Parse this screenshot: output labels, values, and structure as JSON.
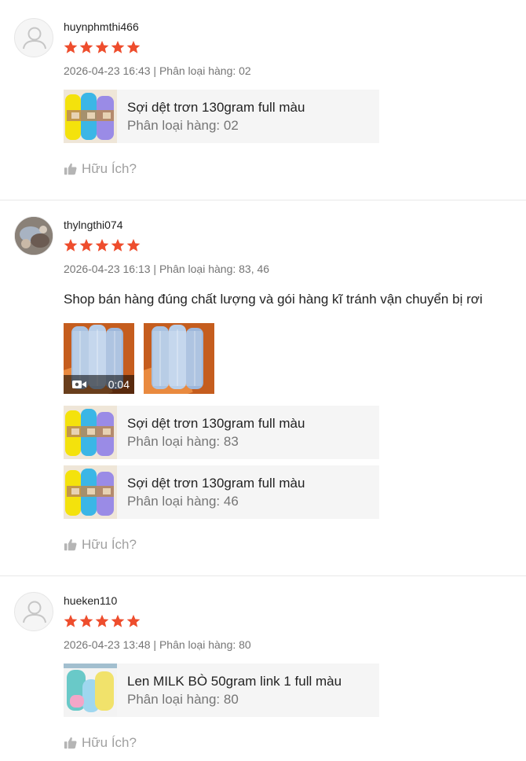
{
  "colors": {
    "star": "#ee4d2d",
    "muted": "#757575",
    "helpful": "#a0a0a0"
  },
  "reviews": [
    {
      "username": "huynphmthi466",
      "rating": 5,
      "meta": "2026-04-23 16:43 | Phân loại hàng: 02",
      "helpful_label": "Hữu Ích?",
      "products": [
        {
          "name": "Sợi dệt trơn 130gram full màu",
          "variation": "Phân loại hàng: 02"
        }
      ]
    },
    {
      "username": "thylngthi074",
      "rating": 5,
      "meta": "2026-04-23 16:13 | Phân loại hàng: 83, 46",
      "comment": "Shop bán hàng đúng chất lượng và gói hàng kĩ tránh vận chuyển bị rơi",
      "video_duration": "0:04",
      "helpful_label": "Hữu Ích?",
      "products": [
        {
          "name": "Sợi dệt trơn 130gram full màu",
          "variation": "Phân loại hàng: 83"
        },
        {
          "name": "Sợi dệt trơn 130gram full màu",
          "variation": "Phân loại hàng: 46"
        }
      ]
    },
    {
      "username": "hueken110",
      "rating": 5,
      "meta": "2026-04-23 13:48 | Phân loại hàng: 80",
      "helpful_label": "Hữu Ích?",
      "products": [
        {
          "name": "Len MILK BÒ 50gram link 1 full màu",
          "variation": "Phân loại hàng: 80"
        }
      ]
    }
  ]
}
